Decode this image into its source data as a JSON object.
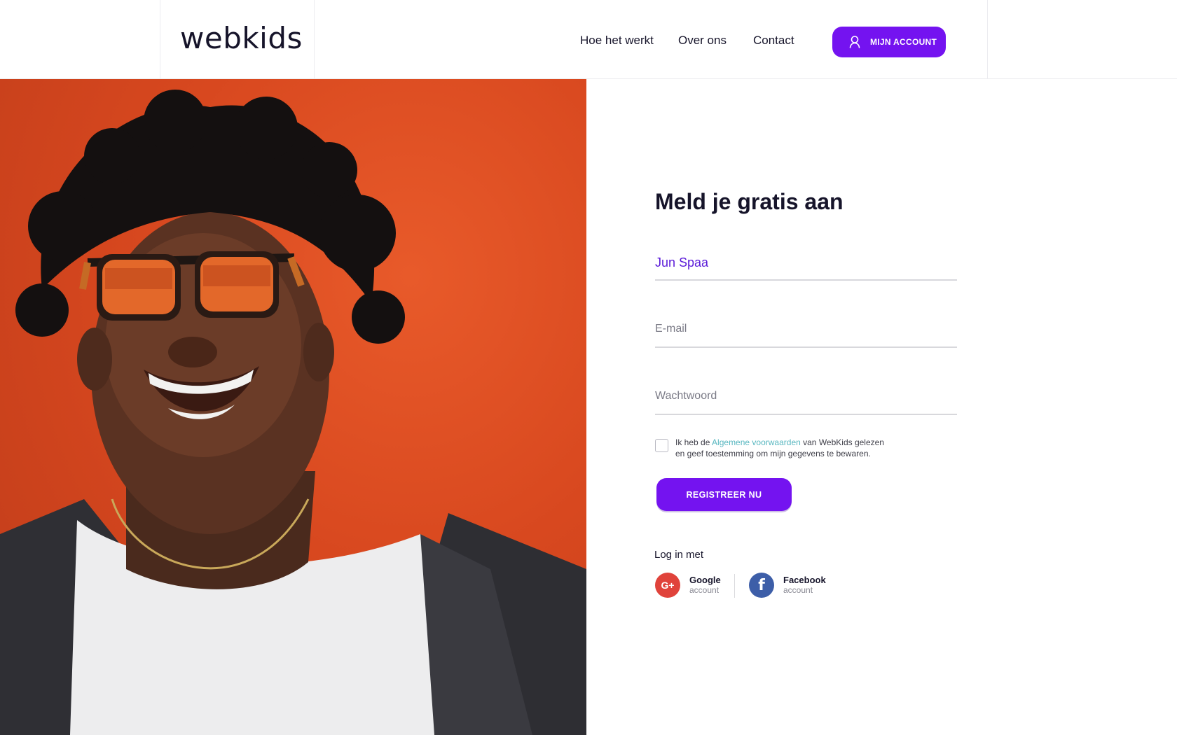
{
  "header": {
    "logo": "webkids",
    "nav": [
      "Hoe het werkt",
      "Over ons",
      "Contact"
    ],
    "account_label": "MIJN ACCOUNT"
  },
  "form": {
    "title": "Meld je gratis aan",
    "name_value": "Jun Spaa",
    "email_placeholder": "E-mail",
    "password_placeholder": "Wachtwoord",
    "terms": {
      "prefix": "Ik  heb de ",
      "link": "Algemene voorwaarden",
      "suffix": " van WebKids gelezen",
      "line2": "en geef toestemming om mijn gegevens te bewaren."
    },
    "register_label": "REGISTREER NU"
  },
  "social": {
    "heading": "Log in met",
    "google": {
      "icon": "G+",
      "name": "Google",
      "sub": "account"
    },
    "facebook": {
      "icon": "f",
      "name": "Facebook",
      "sub": "account"
    }
  },
  "colors": {
    "accent": "#7413f0",
    "link": "#58b7c0",
    "photo_background": "#d8481f",
    "google": "#e0433b",
    "facebook": "#3d5ea8"
  }
}
